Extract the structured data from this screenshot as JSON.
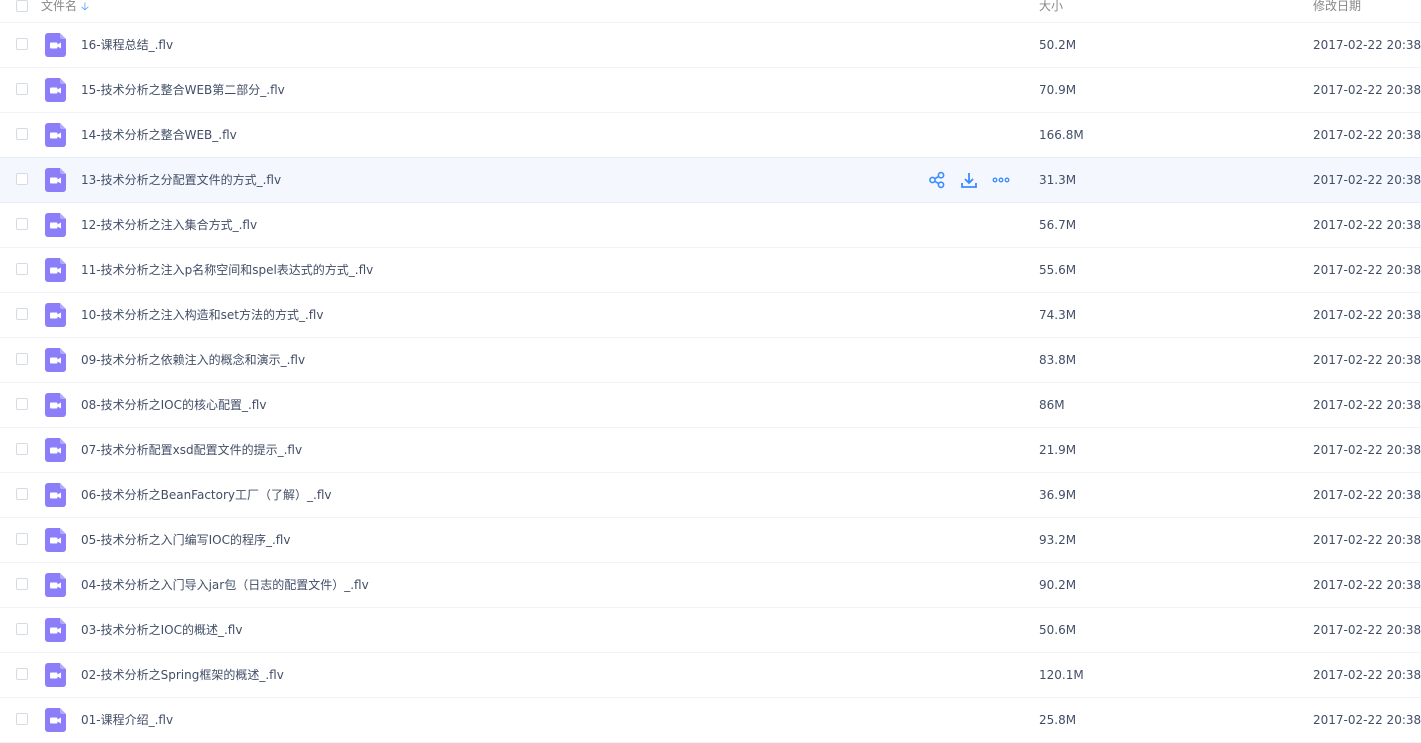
{
  "header": {
    "name_label": "文件名",
    "sort_icon": "arrow-down-icon",
    "size_label": "大小",
    "date_label": "修改日期"
  },
  "colors": {
    "file_icon": "#8b7ef8",
    "accent": "#3b8cff",
    "hover_row": "#f4f8fe"
  },
  "row_actions": [
    "share-icon",
    "download-icon",
    "more-icon"
  ],
  "hovered_row_index": 3,
  "files": [
    {
      "name": "16-课程总结_.flv",
      "size": "50.2M",
      "date": "2017-02-22 20:38"
    },
    {
      "name": "15-技术分析之整合WEB第二部分_.flv",
      "size": "70.9M",
      "date": "2017-02-22 20:38"
    },
    {
      "name": "14-技术分析之整合WEB_.flv",
      "size": "166.8M",
      "date": "2017-02-22 20:38"
    },
    {
      "name": "13-技术分析之分配置文件的方式_.flv",
      "size": "31.3M",
      "date": "2017-02-22 20:38"
    },
    {
      "name": "12-技术分析之注入集合方式_.flv",
      "size": "56.7M",
      "date": "2017-02-22 20:38"
    },
    {
      "name": "11-技术分析之注入p名称空间和spel表达式的方式_.flv",
      "size": "55.6M",
      "date": "2017-02-22 20:38"
    },
    {
      "name": "10-技术分析之注入构造和set方法的方式_.flv",
      "size": "74.3M",
      "date": "2017-02-22 20:38"
    },
    {
      "name": "09-技术分析之依赖注入的概念和演示_.flv",
      "size": "83.8M",
      "date": "2017-02-22 20:38"
    },
    {
      "name": "08-技术分析之IOC的核心配置_.flv",
      "size": "86M",
      "date": "2017-02-22 20:38"
    },
    {
      "name": "07-技术分析配置xsd配置文件的提示_.flv",
      "size": "21.9M",
      "date": "2017-02-22 20:38"
    },
    {
      "name": "06-技术分析之BeanFactory工厂（了解）_.flv",
      "size": "36.9M",
      "date": "2017-02-22 20:38"
    },
    {
      "name": "05-技术分析之入门编写IOC的程序_.flv",
      "size": "93.2M",
      "date": "2017-02-22 20:38"
    },
    {
      "name": "04-技术分析之入门导入jar包（日志的配置文件）_.flv",
      "size": "90.2M",
      "date": "2017-02-22 20:38"
    },
    {
      "name": "03-技术分析之IOC的概述_.flv",
      "size": "50.6M",
      "date": "2017-02-22 20:38"
    },
    {
      "name": "02-技术分析之Spring框架的概述_.flv",
      "size": "120.1M",
      "date": "2017-02-22 20:38"
    },
    {
      "name": "01-课程介绍_.flv",
      "size": "25.8M",
      "date": "2017-02-22 20:38"
    }
  ]
}
